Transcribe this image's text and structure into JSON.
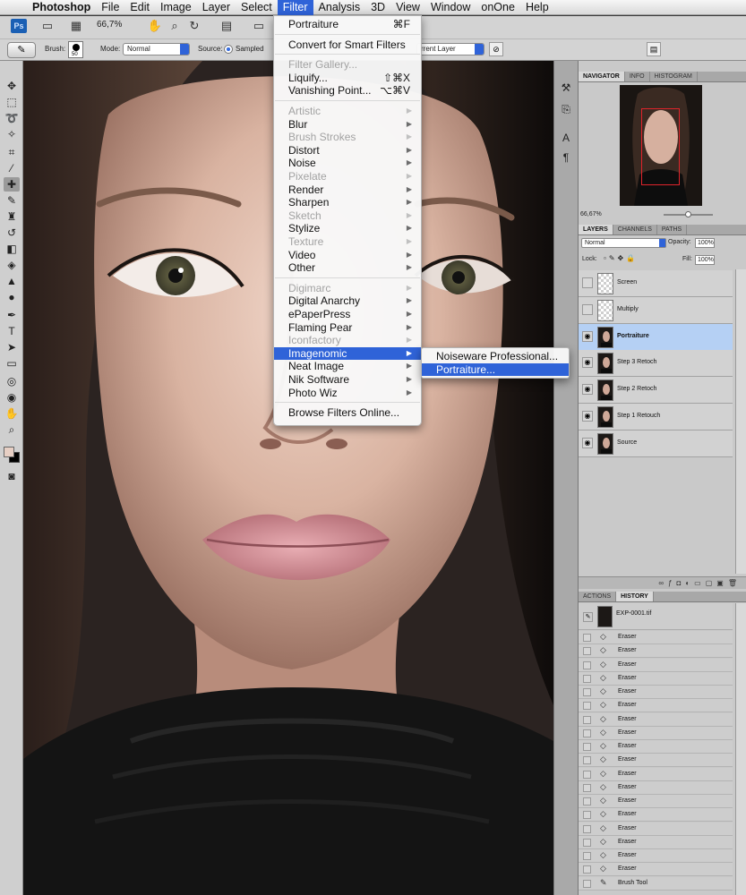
{
  "menubar": {
    "items": [
      "Photoshop",
      "File",
      "Edit",
      "Image",
      "Layer",
      "Select",
      "Filter",
      "Analysis",
      "3D",
      "View",
      "Window",
      "onOne",
      "Help"
    ],
    "active": "Filter"
  },
  "options_bar": {
    "app_icon": "Ps",
    "zoom": "66,7%",
    "brush_label": "Brush:",
    "brush_size": "50",
    "mode_label": "Mode:",
    "mode_value": "Normal",
    "source_label": "Source:",
    "source_value": "Sampled",
    "sample_value": "rrent Layer"
  },
  "filter_menu": {
    "last_filter": {
      "label": "Portraiture",
      "shortcut": "⌘F"
    },
    "convert": "Convert for Smart Filters",
    "group1": [
      {
        "label": "Filter Gallery...",
        "shortcut": "",
        "disabled": true
      },
      {
        "label": "Liquify...",
        "shortcut": "⇧⌘X",
        "disabled": false
      },
      {
        "label": "Vanishing Point...",
        "shortcut": "⌥⌘V",
        "disabled": false
      }
    ],
    "group2": [
      {
        "label": "Artistic",
        "disabled": true
      },
      {
        "label": "Blur",
        "disabled": false
      },
      {
        "label": "Brush Strokes",
        "disabled": true
      },
      {
        "label": "Distort",
        "disabled": false
      },
      {
        "label": "Noise",
        "disabled": false
      },
      {
        "label": "Pixelate",
        "disabled": true
      },
      {
        "label": "Render",
        "disabled": false
      },
      {
        "label": "Sharpen",
        "disabled": false
      },
      {
        "label": "Sketch",
        "disabled": true
      },
      {
        "label": "Stylize",
        "disabled": false
      },
      {
        "label": "Texture",
        "disabled": true
      },
      {
        "label": "Video",
        "disabled": false
      },
      {
        "label": "Other",
        "disabled": false
      }
    ],
    "group3": [
      {
        "label": "Digimarc",
        "disabled": true
      },
      {
        "label": "Digital Anarchy",
        "disabled": false
      },
      {
        "label": "ePaperPress",
        "disabled": false
      },
      {
        "label": "Flaming Pear",
        "disabled": false
      },
      {
        "label": "Iconfactory",
        "disabled": true
      },
      {
        "label": "Imagenomic",
        "disabled": false,
        "highlighted": true
      },
      {
        "label": "Neat Image",
        "disabled": false
      },
      {
        "label": "Nik Software",
        "disabled": false
      },
      {
        "label": "Photo Wiz",
        "disabled": false
      }
    ],
    "browse": "Browse Filters Online..."
  },
  "imagenomic_submenu": [
    {
      "label": "Noiseware Professional...",
      "highlighted": false
    },
    {
      "label": "Portraiture...",
      "highlighted": true
    }
  ],
  "navigator": {
    "tabs": [
      "NAVIGATOR",
      "INFO",
      "HISTOGRAM"
    ],
    "zoom": "66,67%"
  },
  "layers_panel": {
    "tabs": [
      "LAYERS",
      "CHANNELS",
      "PATHS"
    ],
    "blend_mode": "Normal",
    "opacity_label": "Opacity:",
    "opacity": "100%",
    "lock_label": "Lock:",
    "fill_label": "Fill:",
    "fill": "100%",
    "layers": [
      {
        "name": "Screen",
        "visible": false,
        "blank": true,
        "selected": false
      },
      {
        "name": "Multiply",
        "visible": false,
        "blank": true,
        "selected": false
      },
      {
        "name": "Portraiture",
        "visible": true,
        "blank": false,
        "selected": true
      },
      {
        "name": "Step 3 Retoch",
        "visible": true,
        "blank": false,
        "selected": false
      },
      {
        "name": "Step 2 Retoch",
        "visible": true,
        "blank": false,
        "selected": false
      },
      {
        "name": "Step 1 Retouch",
        "visible": true,
        "blank": false,
        "selected": false
      },
      {
        "name": "Source",
        "visible": true,
        "blank": false,
        "selected": false
      }
    ]
  },
  "history_panel": {
    "tabs": [
      "ACTIONS",
      "HISTORY"
    ],
    "snapshot": "EXP-0001.tif",
    "states": [
      "Eraser",
      "Eraser",
      "Eraser",
      "Eraser",
      "Eraser",
      "Eraser",
      "Eraser",
      "Eraser",
      "Eraser",
      "Eraser",
      "Eraser",
      "Eraser",
      "Eraser",
      "Eraser",
      "Eraser",
      "Eraser",
      "Eraser",
      "Eraser",
      "Brush Tool"
    ]
  },
  "colors": {
    "menu_highlight": "#2f63d8",
    "selected_layer": "#b5d0f4",
    "foreground": "#e7cfc4",
    "background": "#000000",
    "navigator_box": "#e0242b"
  }
}
